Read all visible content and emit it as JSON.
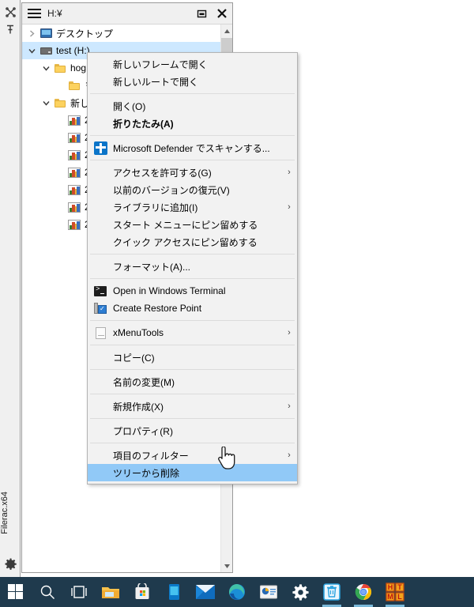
{
  "dock": {
    "icons": [
      {
        "name": "close-all-icon",
        "glyph": "close-x"
      },
      {
        "name": "pin-icon",
        "glyph": "pin"
      }
    ],
    "app_label": "Filerac.x64",
    "settings_icon": "gear-icon"
  },
  "window": {
    "title": "H:¥",
    "menu_icon": "hamburger-icon",
    "restore_icon": "restore-window-icon",
    "close_icon": "close-window-icon"
  },
  "tree": {
    "items": [
      {
        "label": "デスクトップ",
        "icon": "monitor-icon",
        "indent": 0,
        "twisty": "collapsed",
        "selected": false
      },
      {
        "label": "test (H:)",
        "icon": "drive-icon",
        "indent": 0,
        "twisty": "expanded",
        "selected": true
      },
      {
        "label": "hog",
        "icon": "folder-icon",
        "indent": 1,
        "twisty": "expanded",
        "selected": false
      },
      {
        "label": "ヲ",
        "icon": "folder-icon",
        "indent": 2,
        "twisty": "none",
        "selected": false
      },
      {
        "label": "新し",
        "icon": "folder-icon",
        "indent": 1,
        "twisty": "expanded",
        "selected": false
      },
      {
        "label": "2",
        "icon": "picture-file-icon",
        "indent": 2,
        "twisty": "none",
        "selected": false
      },
      {
        "label": "2",
        "icon": "picture-file-icon",
        "indent": 2,
        "twisty": "none",
        "selected": false
      },
      {
        "label": "2",
        "icon": "picture-file-icon",
        "indent": 2,
        "twisty": "none",
        "selected": false
      },
      {
        "label": "2",
        "icon": "picture-file-icon",
        "indent": 2,
        "twisty": "none",
        "selected": false
      },
      {
        "label": "2",
        "icon": "picture-file-icon",
        "indent": 2,
        "twisty": "none",
        "selected": false
      },
      {
        "label": "2",
        "icon": "picture-file-icon",
        "indent": 2,
        "twisty": "none",
        "selected": false
      },
      {
        "label": "2",
        "icon": "picture-file-icon",
        "indent": 2,
        "twisty": "none",
        "selected": false
      }
    ]
  },
  "scrollbar": {
    "up_arrow": "scroll-up-arrow",
    "down_arrow": "scroll-down-arrow"
  },
  "context_menu": {
    "items": [
      {
        "type": "item",
        "label": "新しいフレームで開く",
        "icon": null,
        "submenu": false,
        "bold": false,
        "highlight": false
      },
      {
        "type": "item",
        "label": "新しいルートで開く",
        "icon": null,
        "submenu": false,
        "bold": false,
        "highlight": false
      },
      {
        "type": "separator"
      },
      {
        "type": "item",
        "label": "開く(O)",
        "icon": null,
        "submenu": false,
        "bold": false,
        "highlight": false
      },
      {
        "type": "item",
        "label": "折りたたみ(A)",
        "icon": null,
        "submenu": false,
        "bold": true,
        "highlight": false
      },
      {
        "type": "separator"
      },
      {
        "type": "item",
        "label": "Microsoft Defender でスキャンする...",
        "icon": "defender-shield-icon",
        "submenu": false,
        "bold": false,
        "highlight": false
      },
      {
        "type": "separator"
      },
      {
        "type": "item",
        "label": "アクセスを許可する(G)",
        "icon": null,
        "submenu": true,
        "bold": false,
        "highlight": false
      },
      {
        "type": "item",
        "label": "以前のバージョンの復元(V)",
        "icon": null,
        "submenu": false,
        "bold": false,
        "highlight": false
      },
      {
        "type": "item",
        "label": "ライブラリに追加(I)",
        "icon": null,
        "submenu": true,
        "bold": false,
        "highlight": false
      },
      {
        "type": "item",
        "label": "スタート メニューにピン留めする",
        "icon": null,
        "submenu": false,
        "bold": false,
        "highlight": false
      },
      {
        "type": "item",
        "label": "クイック アクセスにピン留めする",
        "icon": null,
        "submenu": false,
        "bold": false,
        "highlight": false
      },
      {
        "type": "separator"
      },
      {
        "type": "item",
        "label": "フォーマット(A)...",
        "icon": null,
        "submenu": false,
        "bold": false,
        "highlight": false
      },
      {
        "type": "separator"
      },
      {
        "type": "item",
        "label": "Open in Windows Terminal",
        "icon": "terminal-icon",
        "submenu": false,
        "bold": false,
        "highlight": false
      },
      {
        "type": "item",
        "label": "Create Restore Point",
        "icon": "restore-point-icon",
        "submenu": false,
        "bold": false,
        "highlight": false
      },
      {
        "type": "separator"
      },
      {
        "type": "item",
        "label": "xMenuTools",
        "icon": "document-icon",
        "submenu": true,
        "bold": false,
        "highlight": false
      },
      {
        "type": "separator"
      },
      {
        "type": "item",
        "label": "コピー(C)",
        "icon": null,
        "submenu": false,
        "bold": false,
        "highlight": false
      },
      {
        "type": "separator"
      },
      {
        "type": "item",
        "label": "名前の変更(M)",
        "icon": null,
        "submenu": false,
        "bold": false,
        "highlight": false
      },
      {
        "type": "separator"
      },
      {
        "type": "item",
        "label": "新規作成(X)",
        "icon": null,
        "submenu": true,
        "bold": false,
        "highlight": false
      },
      {
        "type": "separator"
      },
      {
        "type": "item",
        "label": "プロパティ(R)",
        "icon": null,
        "submenu": false,
        "bold": false,
        "highlight": false
      },
      {
        "type": "separator"
      },
      {
        "type": "item",
        "label": "項目のフィルター",
        "icon": null,
        "submenu": true,
        "bold": false,
        "highlight": false
      },
      {
        "type": "item",
        "label": "ツリーから削除",
        "icon": null,
        "submenu": false,
        "bold": false,
        "highlight": true
      }
    ],
    "submenu_arrow": "›",
    "highlight_color": "#91c9f7"
  },
  "cursor": {
    "type": "hand-pointer-cursor"
  },
  "taskbar": {
    "background": "#1f3a4d",
    "items": [
      {
        "name": "start-button",
        "icon": "windows-logo-icon",
        "active": false
      },
      {
        "name": "search-button",
        "icon": "search-icon",
        "active": false
      },
      {
        "name": "task-view-button",
        "icon": "task-view-icon",
        "active": false
      },
      {
        "name": "file-explorer-button",
        "icon": "folder-icon",
        "active": false
      },
      {
        "name": "microsoft-store-button",
        "icon": "store-bag-icon",
        "active": false
      },
      {
        "name": "your-phone-button",
        "icon": "phone-icon",
        "active": false
      },
      {
        "name": "mail-button",
        "icon": "mail-envelope-icon",
        "active": false
      },
      {
        "name": "edge-button",
        "icon": "edge-browser-icon",
        "active": false
      },
      {
        "name": "office-app-button",
        "icon": "presentation-icon",
        "active": false
      },
      {
        "name": "settings-button",
        "icon": "gear-icon",
        "active": false
      },
      {
        "name": "recycle-bin-button",
        "icon": "recycle-bin-icon",
        "active": true
      },
      {
        "name": "chrome-button",
        "icon": "chrome-browser-icon",
        "active": true
      },
      {
        "name": "html-editor-button",
        "icon": "html-blocks-icon",
        "active": true
      }
    ]
  }
}
